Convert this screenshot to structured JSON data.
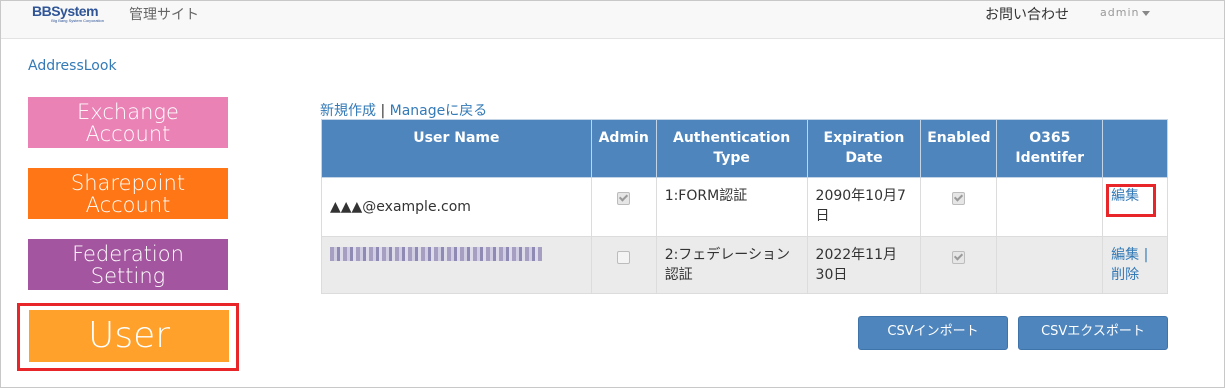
{
  "header": {
    "logo_text": "BBSystem",
    "logo_subtext": "Big Bang System Corporation",
    "site_title": "管理サイト",
    "contact_label": "お問い合わせ",
    "user_menu_label": "admin"
  },
  "breadcrumb": "AddressLook",
  "sidebar": {
    "items": [
      {
        "label_1": "Exchange",
        "label_2": "Account",
        "color": "#ea82b5"
      },
      {
        "label_1": "Sharepoint",
        "label_2": "Account",
        "color": "#ff7616"
      },
      {
        "label_1": "Federation",
        "label_2": "Setting",
        "color": "#a4559f"
      },
      {
        "label_1": "User",
        "color": "#ffa12b"
      }
    ]
  },
  "actions": {
    "create_label": "新規作成",
    "separator": "|",
    "back_label": "Manageに戻る"
  },
  "table": {
    "headers": [
      "User Name",
      "Admin",
      "Authentication Type",
      "Expiration Date",
      "Enabled",
      "O365 Identifer",
      ""
    ],
    "rows": [
      {
        "user_name": "▲▲▲@example.com",
        "admin": true,
        "auth_type": "1:FORM認証",
        "expiration": "2090年10月7日",
        "enabled": true,
        "o365_id": "",
        "edit_label": "編集",
        "delete_label": ""
      },
      {
        "user_name": "",
        "admin": false,
        "auth_type": "2:フェデレーション認証",
        "expiration": "2022年11月30日",
        "enabled": true,
        "o365_id": "",
        "edit_label": "編集",
        "delete_label": "削除"
      }
    ]
  },
  "buttons": {
    "csv_import": "CSVインポート",
    "csv_export": "CSVエクスポート"
  },
  "colors": {
    "accent": "#4e85bd",
    "highlight": "#e8262a",
    "link": "#337ab7"
  }
}
